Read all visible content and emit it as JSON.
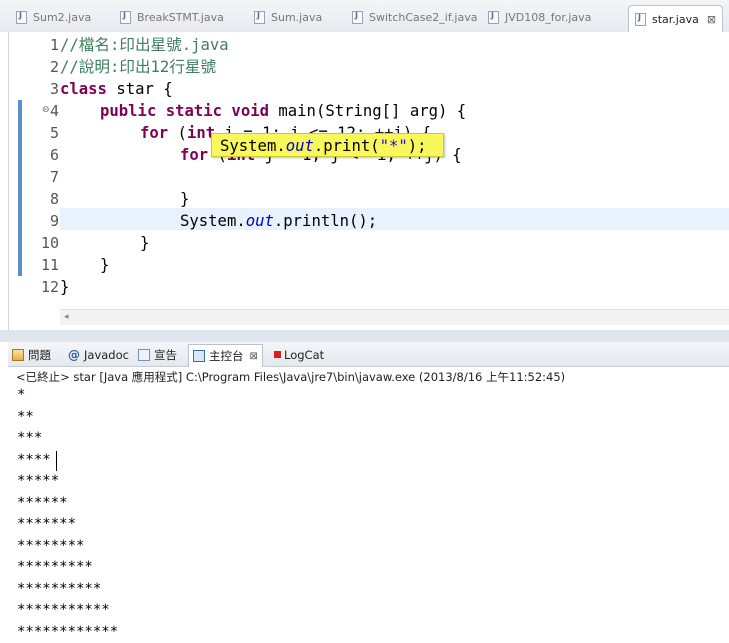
{
  "editor_tabs": [
    {
      "label": "Sum2.java"
    },
    {
      "label": "BreakSTMT.java"
    },
    {
      "label": "Sum.java"
    },
    {
      "label": "SwitchCase2_if.java"
    },
    {
      "label": "JVD108_for.java"
    },
    {
      "label": "star.java",
      "active": true,
      "close": "⊠"
    }
  ],
  "code": {
    "line_numbers": [
      "1",
      "2",
      "3",
      "4",
      "5",
      "6",
      "7",
      "8",
      "9",
      "10",
      "11",
      "12"
    ],
    "line1": {
      "comment": "//檔名:印出星號.java"
    },
    "line2": {
      "comment": "//說明:印出12行星號"
    },
    "line3": {
      "kw": "class",
      "rest": " star {"
    },
    "line4": {
      "kw": "public static void",
      "rest": " main(String[] arg) {"
    },
    "line5": {
      "kw": "for",
      "a": " (",
      "kw2": "int",
      "rest": " i = 1; i <= 12; ++i) {"
    },
    "line6": {
      "kw": "for",
      "a": " (",
      "kw2": "int",
      "rest": " j = 1; j <= i; ++j) {"
    },
    "line8": {
      "text": "}"
    },
    "line9": {
      "a": "System.",
      "field": "out",
      "rest": ".println();"
    },
    "line10": {
      "text": "}"
    },
    "line11": {
      "text": "}"
    },
    "line12": {
      "text": "}"
    },
    "tooltip": {
      "a": "System.",
      "field": "out",
      "b": ".print(",
      "str": "\"*\"",
      "c": ");"
    }
  },
  "panel_tabs": [
    {
      "label": "問題",
      "icon": "problems-icon"
    },
    {
      "label": "Javadoc",
      "icon": "at-icon",
      "glyph": "@"
    },
    {
      "label": "宣告",
      "icon": "declaration-icon"
    },
    {
      "label": "主控台",
      "icon": "console-icon",
      "active": true,
      "close": "⊠"
    },
    {
      "label": "LogCat",
      "icon": "logcat-icon"
    }
  ],
  "console": {
    "header": "<已終止> star [Java 應用程式] C:\\Program Files\\Java\\jre7\\bin\\javaw.exe (2013/8/16 上午11:52:45)",
    "lines": [
      "*",
      "**",
      "***",
      "****",
      "*****",
      "******",
      "*******",
      "********",
      "*********",
      "**********",
      "***********",
      "************"
    ]
  },
  "colors": {
    "keyword": "#7f0055",
    "comment": "#3f7f5f",
    "field": "#0000c0",
    "string": "#2a00ff",
    "tooltip_bg": "#f8f85a",
    "current_line": "#e8f2fe"
  }
}
